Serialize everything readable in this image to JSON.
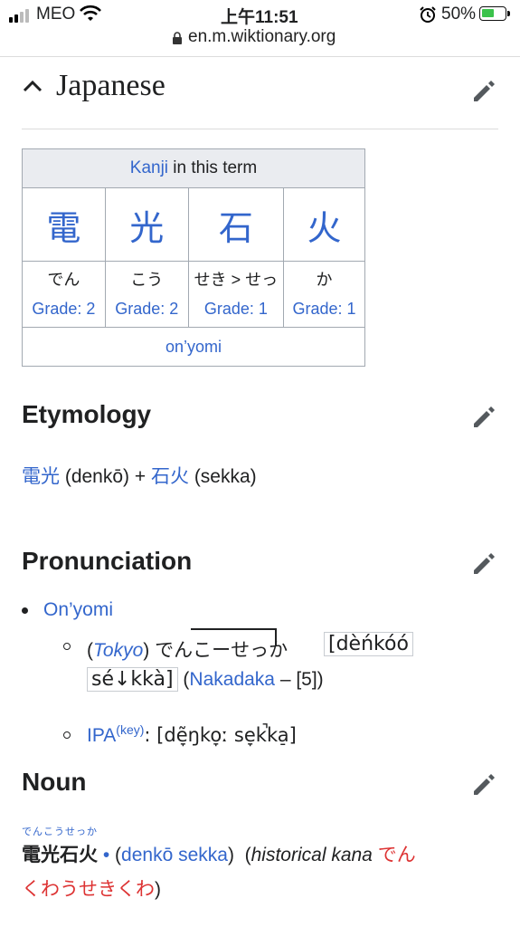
{
  "status": {
    "carrier": "MEO",
    "time": "上午11:51",
    "battery": "50%",
    "url": "en.m.wiktionary.org"
  },
  "heading": {
    "language": "Japanese"
  },
  "kanji_table": {
    "header_link": "Kanji",
    "header_rest": " in this term",
    "cells": [
      {
        "char": "電",
        "reading": "でん",
        "grade": "Grade: 2"
      },
      {
        "char": "光",
        "reading": "こう",
        "grade": "Grade: 2"
      },
      {
        "char": "石",
        "reading": "せき > せっ",
        "grade": "Grade: 1"
      },
      {
        "char": "火",
        "reading": "か",
        "grade": "Grade: 1"
      }
    ],
    "footer": "on’yomi"
  },
  "etymology": {
    "title": "Etymology",
    "part1": "電光",
    "part1_rom": " (denkō) + ",
    "part2": "石火",
    "part2_rom": " (sekka)"
  },
  "pronunciation": {
    "title": "Pronunciation",
    "bullet": "On’yomi",
    "tokyo_pre": "(",
    "tokyo": "Tokyo",
    "tokyo_post": ") ",
    "kana": "でんこーせっか",
    "ipa_a": "[dèńkóó",
    "ipa_b": "sé↓kkà]",
    "naka_pre": " (",
    "nakadaka": "Nakadaka",
    "naka_post": " – [5])",
    "ipa_label": "IPA",
    "key": "(key)",
    "ipa_colon": ": [dẽ̞ŋko̞ː se̞k̚ka̠]"
  },
  "noun": {
    "title": "Noun",
    "ruby": "でんこうせっか",
    "headword": "電光石火",
    "dot": " • ",
    "rom_pre": "(",
    "romaji": "denkō sekka",
    "rom_post": ")",
    "hist_pre": "(",
    "historical": "historical kana",
    "hist_kana_1": " でん",
    "hist_kana_2": "くわうせきくわ",
    "hist_post": ")"
  }
}
